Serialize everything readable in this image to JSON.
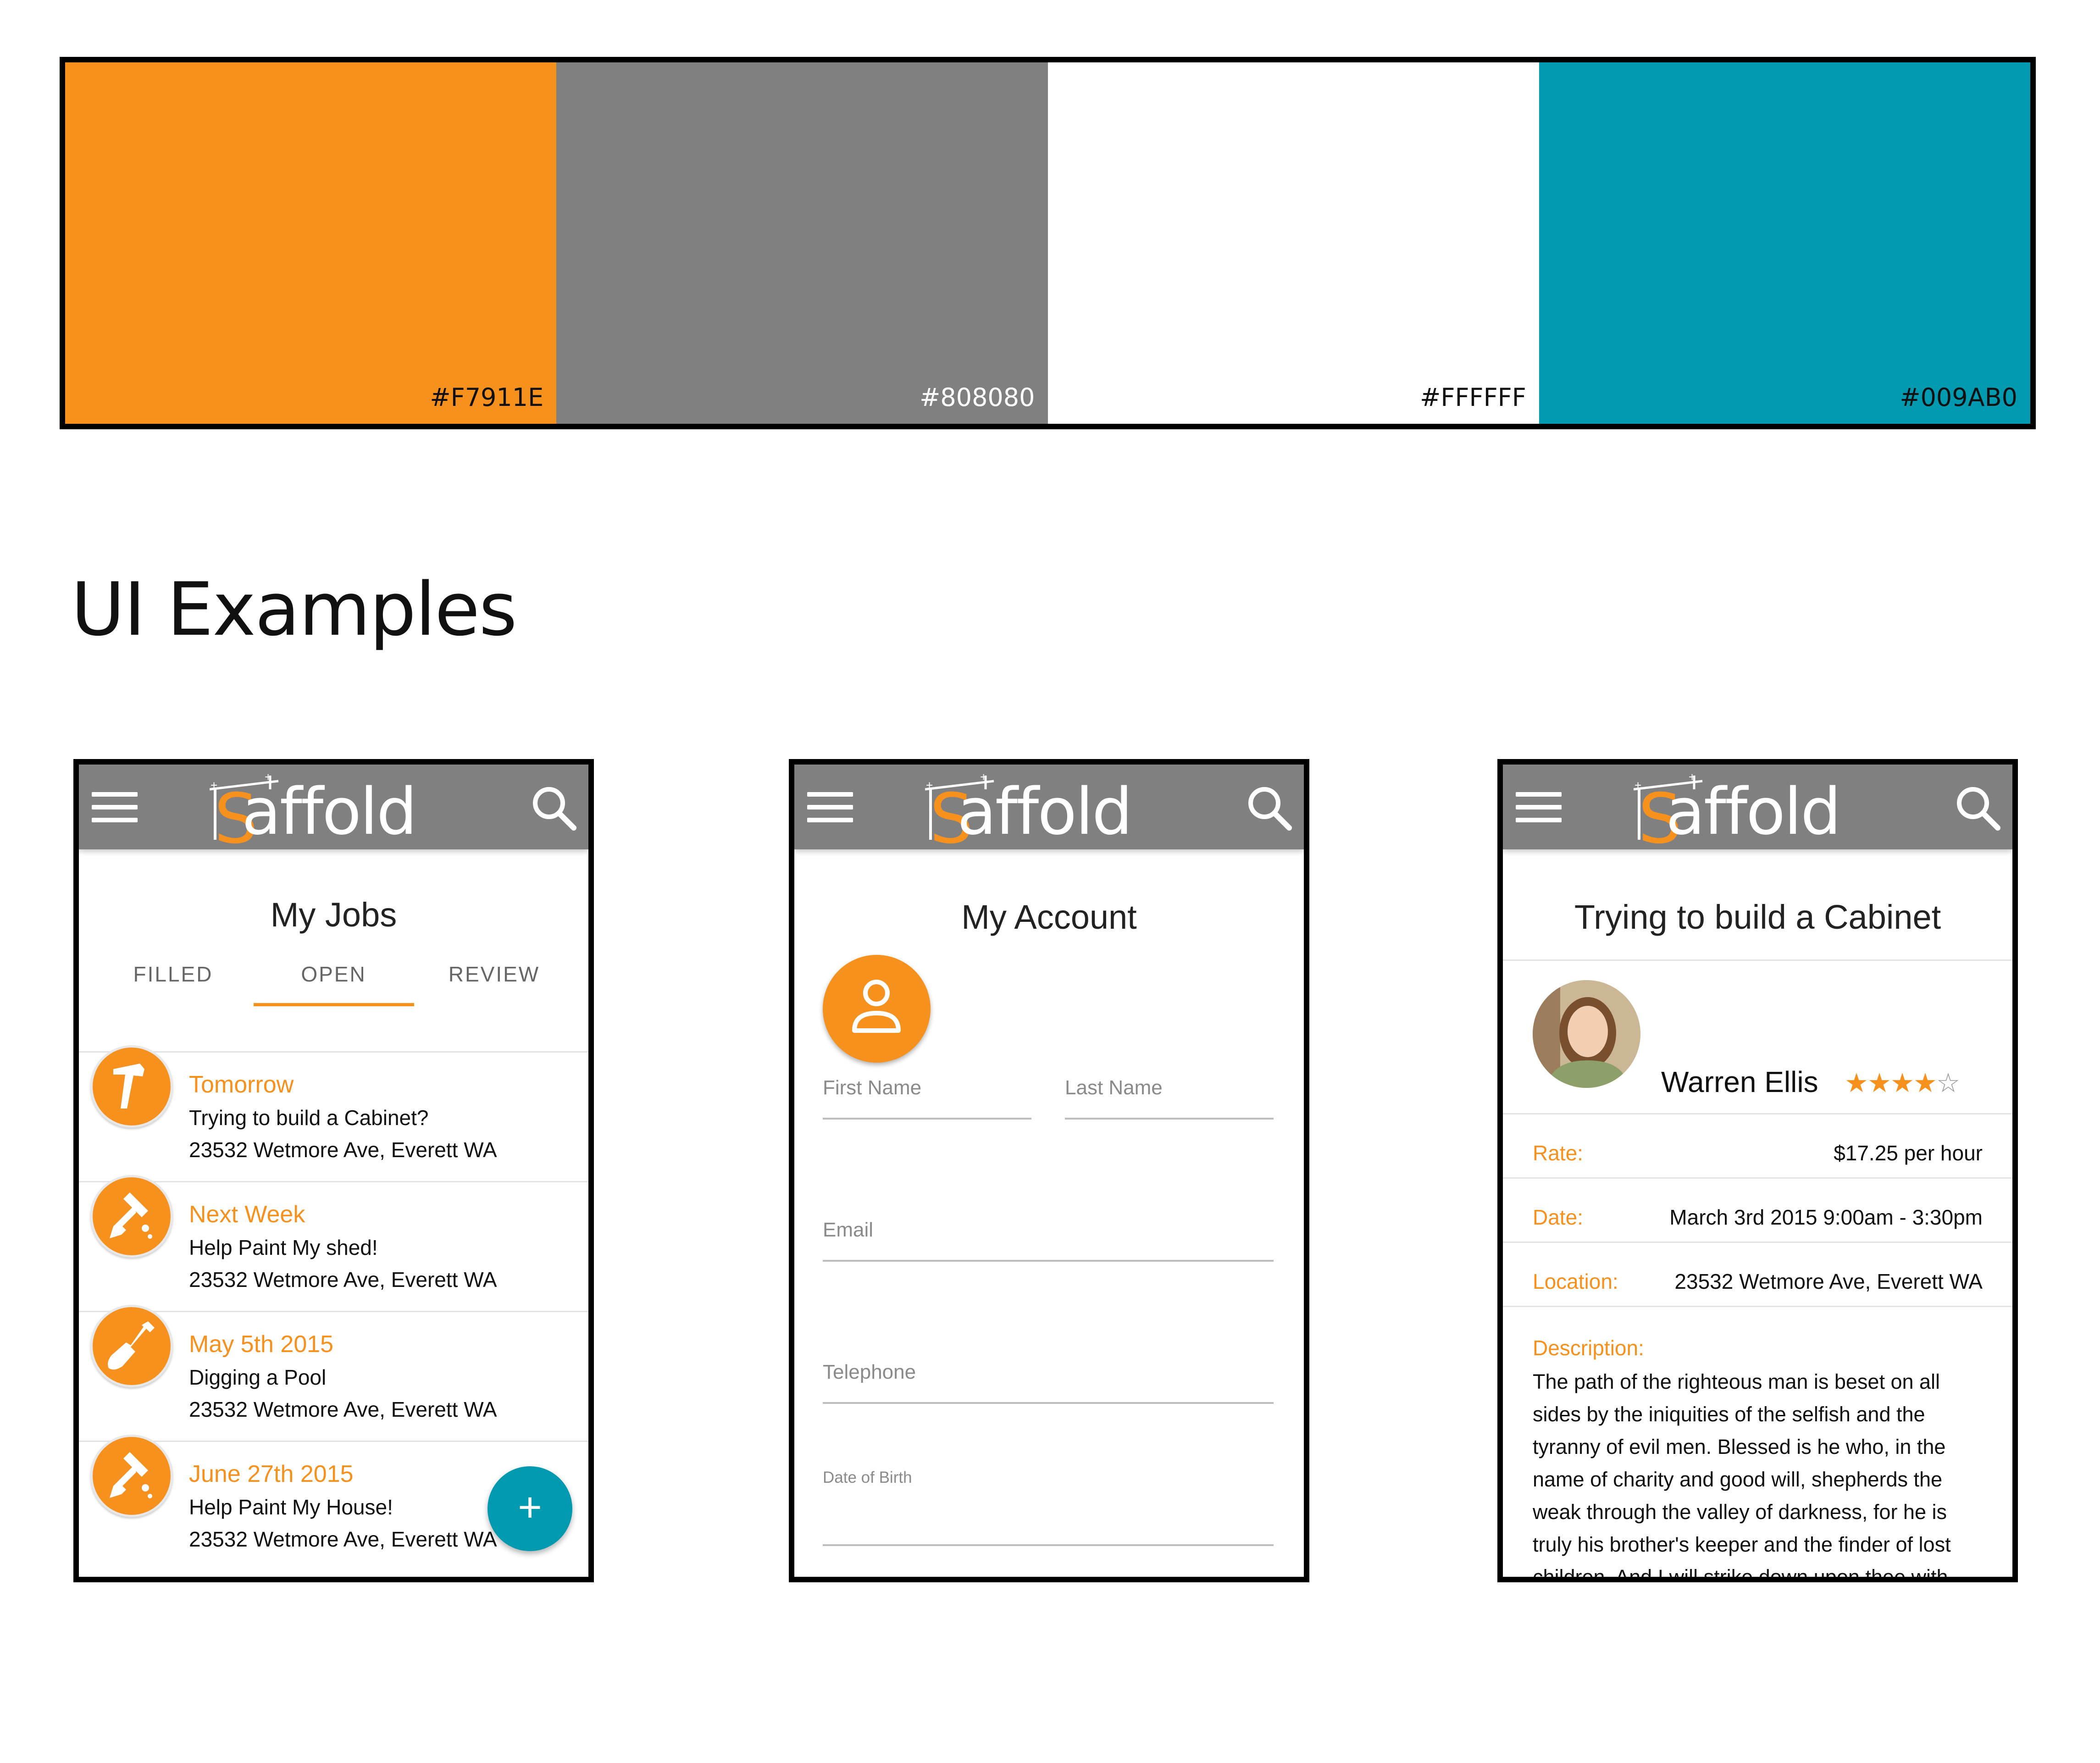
{
  "palette": [
    {
      "color": "#F7911E",
      "code": "#F7911E"
    },
    {
      "color": "#808080",
      "code": "#808080"
    },
    {
      "color": "#FFFFFF",
      "code": "#FFFFFF"
    },
    {
      "color": "#009AB0",
      "code": "#009AB0"
    }
  ],
  "section_title": "UI Examples",
  "app": {
    "logo_text": "affold",
    "logo_initial": "S",
    "accent": "#F7911E",
    "appbar_color": "#808080",
    "fab_color": "#009AB0"
  },
  "jobs_screen": {
    "title": "My Jobs",
    "tabs": [
      "FILLED",
      "OPEN",
      "REVIEW"
    ],
    "active_tab": "OPEN",
    "jobs": [
      {
        "when": "Tomorrow",
        "title": "Trying to build a Cabinet?",
        "address": "23532 Wetmore Ave, Everett WA",
        "icon": "hammer-icon"
      },
      {
        "when": "Next Week",
        "title": "Help Paint My shed!",
        "address": "23532 Wetmore Ave, Everett WA",
        "icon": "paint-roller-icon"
      },
      {
        "when": "May 5th 2015",
        "title": "Digging a Pool",
        "address": "23532 Wetmore Ave, Everett WA",
        "icon": "shovel-icon"
      },
      {
        "when": "June 27th 2015",
        "title": "Help Paint My House!",
        "address": "23532 Wetmore Ave, Everett WA",
        "icon": "paint-roller-icon"
      }
    ],
    "fab_label": "+"
  },
  "account_screen": {
    "title": "My Account",
    "first_name_label": "First Name",
    "last_name_label": "Last Name",
    "email_label": "Email",
    "telephone_label": "Telephone",
    "dob_label": "Date of Birth"
  },
  "job_detail_screen": {
    "title": "Trying to build a Cabinet",
    "person_name": "Warren Ellis",
    "rating": 4,
    "rating_max": 5,
    "rate_label": "Rate:",
    "rate_value": "$17.25 per hour",
    "date_label": "Date:",
    "date_value": "March 3rd 2015 9:00am - 3:30pm",
    "location_label": "Location:",
    "location_value": "23532 Wetmore Ave, Everett WA",
    "description_label": "Description:",
    "description": "The path of the righteous man is beset on all sides by the iniquities of the selfish and the tyranny of evil men. Blessed is he who, in the name of charity and good will, shepherds the weak through the valley of darkness, for he is truly his brother's keeper and the finder of lost children. And I will strike down upon thee with"
  }
}
